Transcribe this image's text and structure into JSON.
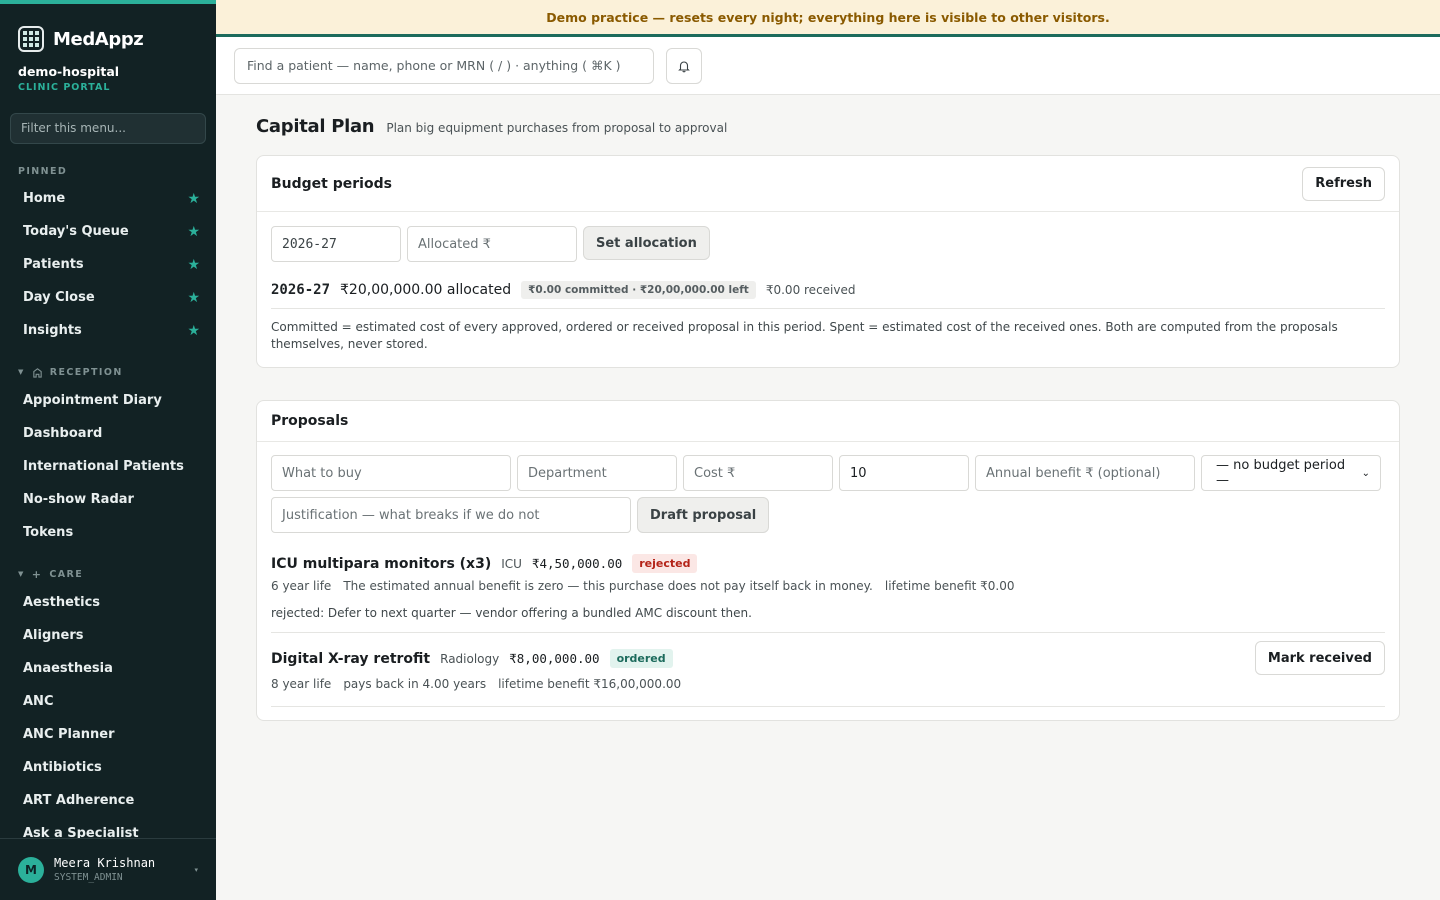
{
  "sidebar": {
    "brand": "MedAppz",
    "org_name": "demo-hospital",
    "org_sub": "CLINIC PORTAL",
    "filter_placeholder": "Filter this menu...",
    "pinned_label": "PINNED",
    "pinned": [
      "Home",
      "Today's Queue",
      "Patients",
      "Day Close",
      "Insights"
    ],
    "reception_label": "RECEPTION",
    "reception": [
      "Appointment Diary",
      "Dashboard",
      "International Patients",
      "No-show Radar",
      "Tokens"
    ],
    "care_label": "CARE",
    "care": [
      "Aesthetics",
      "Aligners",
      "Anaesthesia",
      "ANC",
      "ANC Planner",
      "Antibiotics",
      "ART Adherence",
      "Ask a Specialist"
    ]
  },
  "user": {
    "initial": "M",
    "name": "Meera Krishnan",
    "role": "SYSTEM_ADMIN"
  },
  "banner": "Demo practice — resets every night; everything here is visible to other visitors.",
  "search_placeholder": "Find a patient — name, phone or MRN ( / ) · anything ( ⌘K )",
  "page": {
    "title": "Capital Plan",
    "subtitle": "Plan big equipment purchases from proposal to approval"
  },
  "budget": {
    "title": "Budget periods",
    "refresh": "Refresh",
    "period_field": "2026-27",
    "allocated_placeholder": "Allocated ₹",
    "set_button": "Set allocation",
    "period_year": "2026-27",
    "allocated": "₹20,00,000.00 allocated",
    "committed_chip": "₹0.00 committed · ₹20,00,000.00 left",
    "received": "₹0.00 received",
    "note": "Committed = estimated cost of every approved, ordered or received proposal in this period. Spent = estimated cost of the received ones. Both are computed from the proposals themselves, never stored."
  },
  "proposals": {
    "title": "Proposals",
    "what_placeholder": "What to buy",
    "dept_placeholder": "Department",
    "cost_placeholder": "Cost ₹",
    "life_value": "10",
    "benefit_placeholder": "Annual benefit ₹ (optional)",
    "period_select": "— no budget period —",
    "justification_placeholder": "Justification — what breaks if we do not",
    "draft_button": "Draft proposal",
    "items": [
      {
        "name": "ICU multipara monitors (x3)",
        "dept": "ICU",
        "cost": "₹4,50,000.00",
        "status": "rejected",
        "life": "6 year life",
        "payback": "The estimated annual benefit is zero — this purchase does not pay itself back in money.",
        "lifetime": "lifetime benefit ₹0.00",
        "reason": "rejected: Defer to next quarter — vendor offering a bundled AMC discount then."
      },
      {
        "name": "Digital X-ray retrofit",
        "dept": "Radiology",
        "cost": "₹8,00,000.00",
        "status": "ordered",
        "life": "8 year life",
        "payback": "pays back in 4.00 years",
        "lifetime": "lifetime benefit ₹16,00,000.00",
        "action": "Mark received"
      }
    ]
  },
  "colors": {
    "sidebar_bg": "#122224",
    "accent": "#2bb09a",
    "banner_bg": "#fbf1d9",
    "banner_text": "#8a5a00",
    "rejected": "#b42318",
    "ordered": "#1c6b5c"
  },
  "icons": [
    "brand-logo-icon",
    "star-icon",
    "building-icon",
    "plus-icon",
    "bell-icon",
    "chevron-down-icon"
  ]
}
